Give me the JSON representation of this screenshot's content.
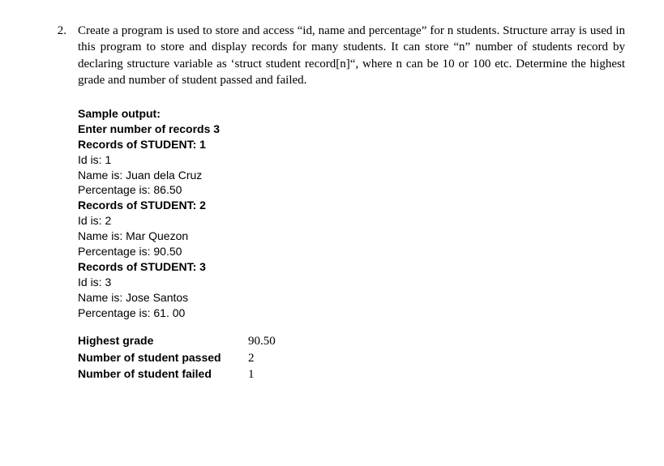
{
  "question": {
    "number": "2.",
    "text": "Create a program is used to store and access “id, name and percentage” for n students. Structure array is used in this program to store and display records for many students. It can store “n” number of students record by declaring structure variable as ‘struct student record[n]“, where n can be 10 or 100 etc. Determine the highest grade and number of student passed and failed."
  },
  "output": {
    "heading": "Sample output:",
    "enter_line": "Enter number of records 3",
    "records": [
      {
        "header": "Records of STUDENT: 1",
        "id": "Id is: 1",
        "name": "Name is: Juan dela Cruz",
        "pct": "Percentage is: 86.50"
      },
      {
        "header": "Records of STUDENT: 2",
        "id": "Id is: 2",
        "name": "Name is: Mar Quezon",
        "pct": "Percentage is: 90.50"
      },
      {
        "header": "Records of STUDENT: 3",
        "id": "Id is: 3",
        "name": "Name is: Jose Santos",
        "pct": "Percentage is: 61. 00"
      }
    ],
    "summary": {
      "highest_label": "Highest grade",
      "highest_value": "90.50",
      "passed_label": "Number of student passed",
      "passed_value": "2",
      "failed_label": "Number of student failed",
      "failed_value": "1"
    }
  }
}
